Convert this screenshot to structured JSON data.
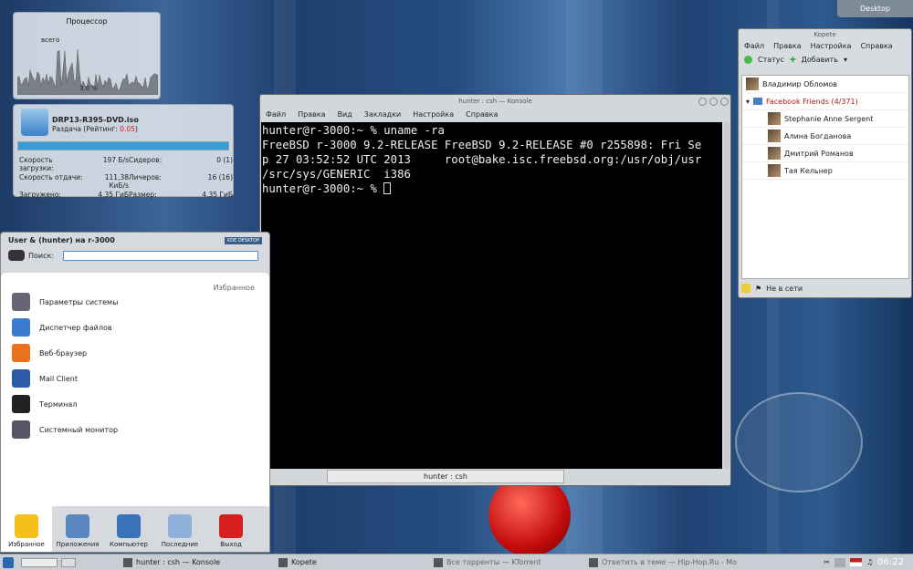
{
  "desktop_button": "Desktop",
  "cpu_widget": {
    "title": "Процессор",
    "label_all": "всего",
    "percent": "3.0 %"
  },
  "torrent_widget": {
    "name": "DRP13-R395-DVD.iso",
    "status_prefix": "Раздача (Рейтинг: ",
    "rating": "0.05",
    "status_suffix": ")",
    "progress": 1.0,
    "rows": [
      [
        "Скорость загрузки:",
        "197 Б/s",
        "Сидеров:",
        "0 (1)"
      ],
      [
        "Скорость отдачи:",
        "111,38 КиБ/s",
        "Личеров:",
        "16 (16)"
      ],
      [
        "Загружено:",
        "4,35 ГиБ",
        "Размер:",
        "4,35 ГиБ"
      ]
    ]
  },
  "kopete": {
    "title": "Kopete",
    "menu": [
      "Файл",
      "Правка",
      "Настройка",
      "Справка"
    ],
    "toolbar": {
      "status": "Статус",
      "add": "Добавить"
    },
    "contacts": [
      {
        "name": "Владимир Обломов",
        "indent": false
      },
      {
        "name": "Facebook Friends (4/371)",
        "group": true
      },
      {
        "name": "Stephanie Anne Sergent",
        "indent": true
      },
      {
        "name": "Алина Богданова",
        "indent": true
      },
      {
        "name": "Дмитрий Романов",
        "indent": true
      },
      {
        "name": "Тая Кельнер",
        "indent": true
      }
    ],
    "status_text": "Не в сети"
  },
  "konsole": {
    "title": "hunter : csh — Konsole",
    "menu": [
      "Файл",
      "Правка",
      "Вид",
      "Закладки",
      "Настройка",
      "Справка"
    ],
    "lines": [
      "hunter@r-3000:~ % uname -ra",
      "FreeBSD r-3000 9.2-RELEASE FreeBSD 9.2-RELEASE #0 r255898: Fri Se",
      "p 27 03:52:52 UTC 2013     root@bake.isc.freebsd.org:/usr/obj/usr",
      "/src/sys/GENERIC  i386"
    ],
    "prompt": "hunter@r-3000:~ % ",
    "tab": "hunter : csh"
  },
  "kickoff": {
    "user": "User & (hunter) на r-3000",
    "badge": "KDE DESKTOP",
    "search_label": "Поиск:",
    "search_value": "",
    "favorites_header": "Избранное",
    "favorites": [
      "Параметры системы",
      "Диспетчер файлов",
      "Веб-браузер",
      "Mail Client",
      "Терминал",
      "Системный монитор"
    ],
    "tabs": [
      "Избранное",
      "Приложения",
      "Компьютер",
      "Последние",
      "Выход"
    ]
  },
  "taskbar": {
    "tasks": [
      "hunter : csh — Konsole",
      "Kopete",
      "Все торренты — KTorrent",
      "Ответить в теме — Hip-Hop.Ru - Mo"
    ],
    "clock": "06:22"
  },
  "colors": {
    "rating": "#d02020",
    "progress": "#3a9ad8",
    "exit": "#d81e1e",
    "group": "#b01818"
  }
}
